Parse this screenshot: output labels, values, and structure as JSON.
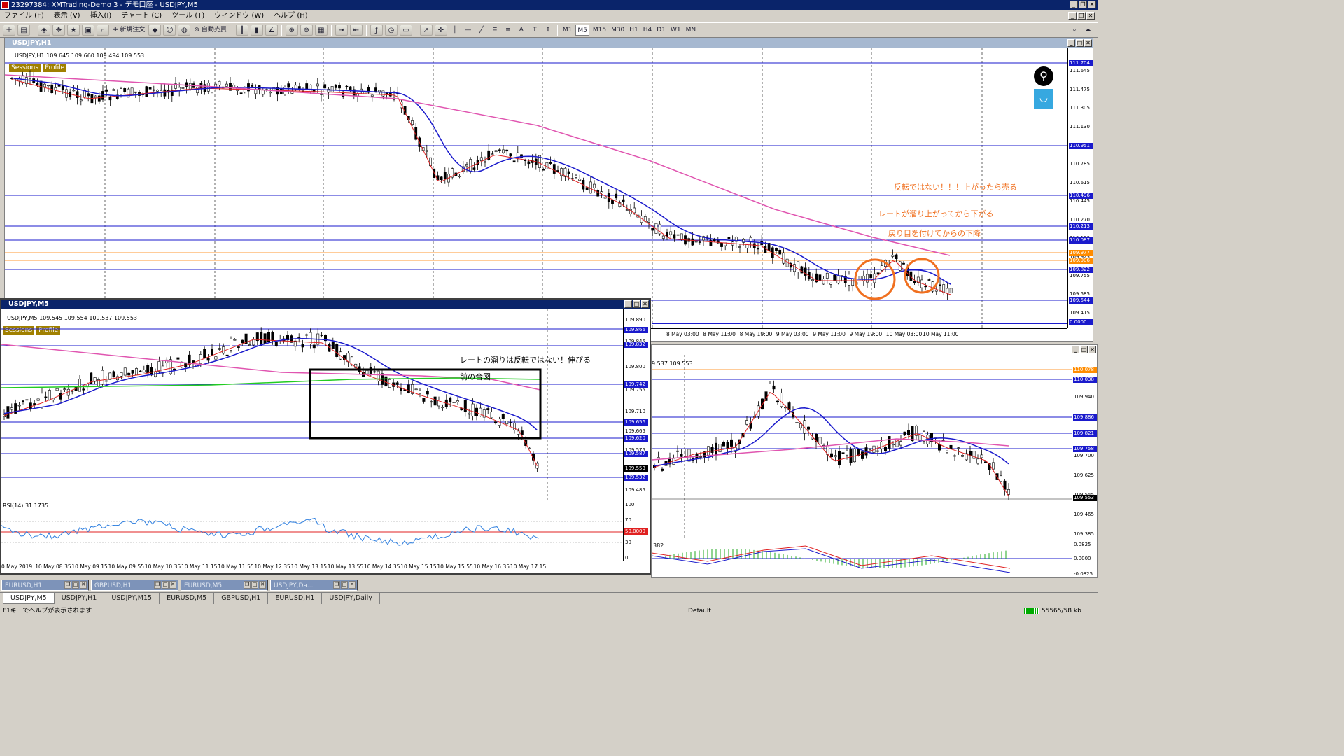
{
  "app": {
    "title": "23297384: XMTrading-Demo 3 - デモ口座 - USDJPY,M5"
  },
  "menu": [
    "ファイル (F)",
    "表示 (V)",
    "挿入(I)",
    "チャート (C)",
    "ツール (T)",
    "ウィンドウ (W)",
    "ヘルプ (H)"
  ],
  "toolbar": {
    "new_order": "新規注文",
    "auto_trade": "自動売買",
    "timeframes": [
      "M1",
      "M5",
      "M15",
      "M30",
      "H1",
      "H4",
      "D1",
      "W1",
      "MN"
    ]
  },
  "h1_chart": {
    "window_title": "USDJPY,H1",
    "info": "USDJPY,H1  109.645 109.660 109.494 109.553",
    "sessions_label": "Sessions",
    "profile_label": "Profile",
    "price_ticks": [
      "111.645",
      "111.475",
      "111.305",
      "111.130",
      "110.955",
      "110.785",
      "110.615",
      "110.445",
      "110.270",
      "110.100",
      "109.925",
      "109.755",
      "109.585",
      "109.415"
    ],
    "price_labels": [
      {
        "text": "111.704",
        "color": "blue"
      },
      {
        "text": "110.951",
        "color": "blue"
      },
      {
        "text": "110.496",
        "color": "blue"
      },
      {
        "text": "110.213",
        "color": "blue"
      },
      {
        "text": "110.087",
        "color": "blue"
      },
      {
        "text": "109.977",
        "color": "orange"
      },
      {
        "text": "109.906",
        "color": "orange"
      },
      {
        "text": "109.822",
        "color": "blue"
      },
      {
        "text": "109.544",
        "color": "blue"
      },
      {
        "text": "0.0000",
        "color": "blue"
      }
    ],
    "time_labels": [
      "8 May 03:00",
      "8 May 11:00",
      "8 May 19:00",
      "9 May 03:00",
      "9 May 11:00",
      "9 May 19:00",
      "10 May 03:00",
      "10 May 11:00"
    ],
    "annotations": [
      "反転ではない！！！上がったら売る",
      "レートが溜り上がってから下がる",
      "戻り目を付けてからの下降"
    ]
  },
  "m5_chart": {
    "window_title": "USDJPY,M5",
    "info": "USDJPY,M5  109.545 109.554 109.537 109.553",
    "sessions_label": "Sessions",
    "profile_label": "Profile",
    "price_ticks": [
      "109.890",
      "109.845",
      "109.800",
      "109.755",
      "109.710",
      "109.665",
      "109.575",
      "109.530",
      "109.485"
    ],
    "price_labels": [
      {
        "text": "109.866",
        "color": "blue"
      },
      {
        "text": "109.832",
        "color": "blue"
      },
      {
        "text": "109.742",
        "color": "blue"
      },
      {
        "text": "109.656",
        "color": "blue"
      },
      {
        "text": "109.620",
        "color": "blue"
      },
      {
        "text": "109.587",
        "color": "blue"
      },
      {
        "text": "109.553",
        "color": "black"
      },
      {
        "text": "109.532",
        "color": "blue"
      }
    ],
    "annotation_line1": "レートの溜りは反転ではない！伸びる",
    "annotation_line2": "前の合図",
    "rsi_label": "RSI(14) 31.1735",
    "rsi_ticks": [
      "100",
      "70",
      "30",
      "0"
    ],
    "rsi_level_label": "50.0000",
    "time_labels": [
      "0 May 2019",
      "10 May 08:35",
      "10 May 09:15",
      "10 May 09:55",
      "10 May 10:35",
      "10 May 11:15",
      "10 May 11:55",
      "10 May 12:35",
      "10 May 13:15",
      "10 May 13:55",
      "10 May 14:35",
      "10 May 15:15",
      "10 May 15:55",
      "10 May 16:35",
      "10 May 17:15"
    ]
  },
  "m15_chart": {
    "info": "9.537 109.553",
    "price_ticks": [
      "110.015",
      "109.940",
      "109.860",
      "109.780",
      "109.700",
      "109.625",
      "109.545",
      "109.465",
      "109.385"
    ],
    "price_labels": [
      {
        "text": "110.078",
        "color": "orange"
      },
      {
        "text": "110.038",
        "color": "blue"
      },
      {
        "text": "109.886",
        "color": "blue"
      },
      {
        "text": "109.821",
        "color": "blue"
      },
      {
        "text": "109.758",
        "color": "blue"
      },
      {
        "text": "109.553",
        "color": "black"
      }
    ],
    "macd_value": "382",
    "macd_ticks": [
      "0.0825",
      "0.0000",
      "-0.0825"
    ]
  },
  "minimized_tabs": [
    "EURUSD,H1",
    "GBPUSD,H1",
    "EURUSD,M5",
    "USDJPY,Da..."
  ],
  "chart_tabs": [
    "USDJPY,M5",
    "USDJPY,H1",
    "USDJPY,M15",
    "EURUSD,M5",
    "GBPUSD,H1",
    "EURUSD,H1",
    "USDJPY,Daily"
  ],
  "status": {
    "help": "F1キーでヘルプが表示されます",
    "profile": "Default",
    "traffic": "55565/58 kb"
  }
}
